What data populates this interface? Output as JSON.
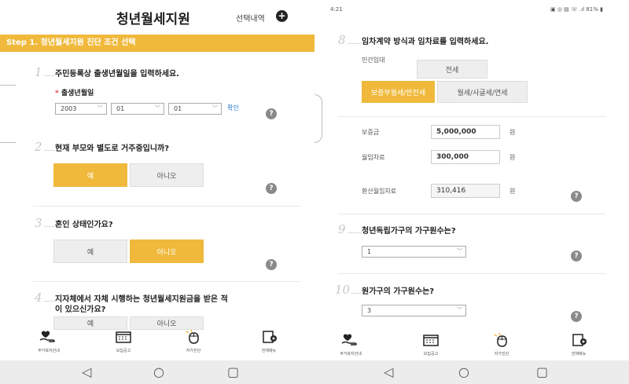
{
  "left": {
    "header": {
      "title": "청년월세지원",
      "history": "선택내역"
    },
    "step": {
      "label": "Step 1.",
      "title": "청년월세지원 진단 조건 선택"
    },
    "q1": {
      "num": "1",
      "text": "주민등록상 출생년월일을 입력하세요.",
      "required_mark": "*",
      "label": "출생년월일",
      "year": "2003",
      "month": "01",
      "day": "01",
      "confirm": "확인"
    },
    "q2": {
      "num": "2",
      "text": "현재 부모와 별도로 거주중입니까?",
      "yes": "예",
      "no": "아니오",
      "selected": "yes"
    },
    "q3": {
      "num": "3",
      "text": "혼인 상태인가요?",
      "yes": "예",
      "no": "아니오",
      "selected": "no"
    },
    "q4": {
      "num": "4",
      "text_line1": "지자체에서 자체 시행하는 청년월세지원금을 받은 적",
      "text_line2": "이 있으신가요?",
      "yes": "예",
      "no": "아니오"
    },
    "nav": [
      {
        "icon": "heart-hand-icon",
        "label": "주거복지안내"
      },
      {
        "icon": "calendar-icon",
        "label": "모집공고"
      },
      {
        "icon": "mouse-icon",
        "label": "자가진단"
      },
      {
        "icon": "menu-plus-icon",
        "label": "전체메뉴"
      }
    ]
  },
  "right": {
    "status": {
      "time": "4:21",
      "icons": "▣ ◎ ▤ ☏ .ıl 81% ▮"
    },
    "q8": {
      "num": "8",
      "text": "임차계약 방식과 임차료를 입력하세요.",
      "group_label": "민간임대",
      "opt_jeonse": "전세",
      "opt_bojeung": "보증부월세/반전세",
      "opt_wolse": "월세/사글세/연세"
    },
    "deposit": {
      "label": "보증금",
      "value": "5,000,000",
      "unit": "원"
    },
    "rent": {
      "label": "월임차료",
      "value": "300,000",
      "unit": "원"
    },
    "converted": {
      "label": "환산월임차료",
      "value": "310,416",
      "unit": "원"
    },
    "q9": {
      "num": "9",
      "text": "청년독립가구의 가구원수는?",
      "value": "1"
    },
    "q10": {
      "num": "10",
      "text": "원가구의 가구원수는?",
      "value": "3"
    },
    "nav": [
      {
        "icon": "heart-hand-icon",
        "label": "주거복지안내"
      },
      {
        "icon": "calendar-icon",
        "label": "모집공고"
      },
      {
        "icon": "mouse-icon",
        "label": "자가진단"
      },
      {
        "icon": "menu-plus-icon",
        "label": "전체메뉴"
      }
    ]
  },
  "colors": {
    "accent": "#f0b93b",
    "link": "#2c7bd8",
    "required": "#e04848"
  },
  "sysnav": {
    "back": "◁",
    "home": "○",
    "recent": "▢"
  }
}
